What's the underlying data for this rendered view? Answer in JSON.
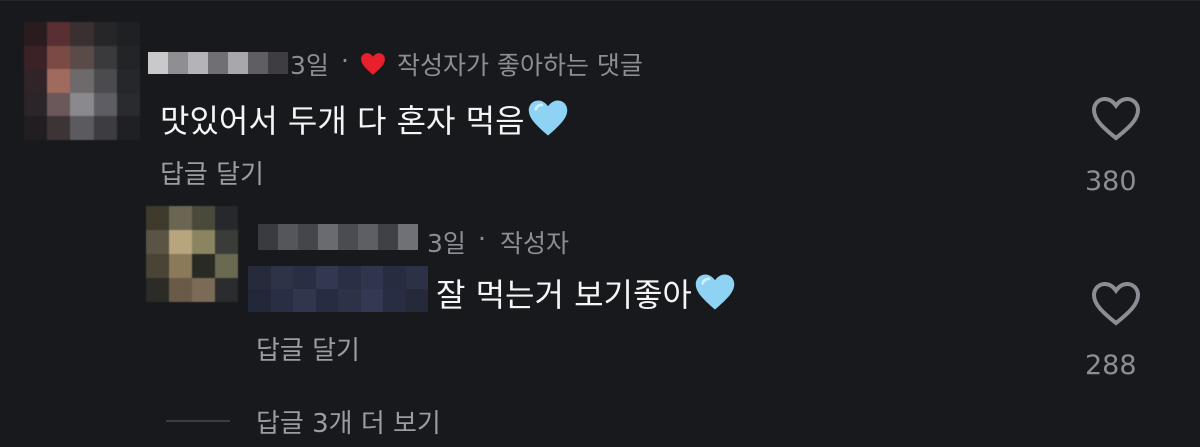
{
  "comment": {
    "time": "3일",
    "separator": "·",
    "liked_by_author": "작성자가 좋아하는 댓글",
    "text": "맛있어서 두개 다 혼자 먹음",
    "reply_label": "답글 달기",
    "like_count": "380"
  },
  "reply": {
    "time": "3일",
    "separator": "·",
    "author_badge": "작성자",
    "text": "잘 먹는거 보기좋아",
    "reply_label": "답글 달기",
    "like_count": "288"
  },
  "more_replies": "답글 3개 더 보기",
  "colors": {
    "background": "#17191d",
    "meta_text": "#8b8e94",
    "heart_red": "#e8202b",
    "heart_blue": "#8fd3f4"
  },
  "icons": {
    "liked_by_author": "red-heart-icon",
    "emoji": "light-blue-heart-emoji",
    "like": "heart-outline-icon"
  }
}
